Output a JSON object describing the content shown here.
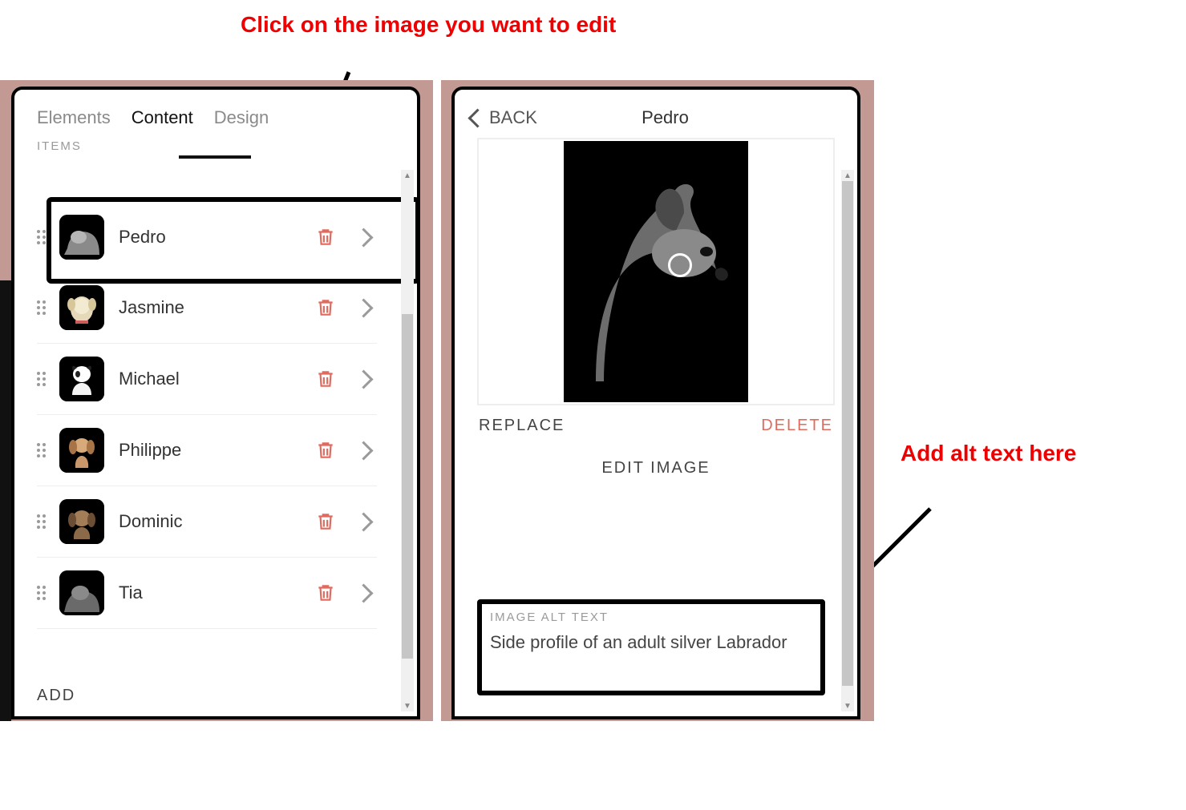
{
  "annotations": {
    "callout_1": "Click on the image you want to edit",
    "callout_2": "Add alt text here"
  },
  "left_panel": {
    "tabs": {
      "elements": "Elements",
      "content": "Content",
      "design": "Design"
    },
    "items_header": "ITEMS",
    "items": [
      {
        "name": "Pedro"
      },
      {
        "name": "Jasmine"
      },
      {
        "name": "Michael"
      },
      {
        "name": "Philippe"
      },
      {
        "name": "Dominic"
      },
      {
        "name": "Tia"
      }
    ],
    "add_label": "ADD"
  },
  "right_panel": {
    "back_label": "BACK",
    "title": "Pedro",
    "replace_label": "REPLACE",
    "delete_label": "DELETE",
    "edit_image_label": "EDIT IMAGE",
    "alt_section_label": "IMAGE ALT TEXT",
    "alt_text_value": "Side profile of an adult silver Labrador"
  },
  "colors": {
    "danger": "#e06a5e",
    "annotation": "#e00000"
  }
}
